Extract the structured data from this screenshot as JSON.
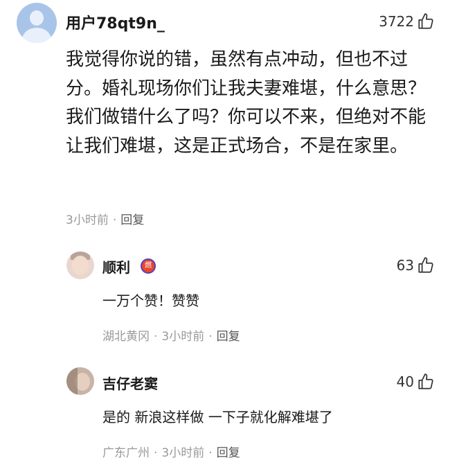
{
  "main_comment": {
    "username": "用户78qt9n_",
    "likes": "3722",
    "text": "我觉得你说的错，虽然有点冲动，但也不过分。婚礼现场你们让我夫妻难堪，什么意思？我们做错什么了吗？你可以不来，但绝对不能让我们难堪，这是正式场合，不是在家里。",
    "time": "3小时前",
    "reply_label": "回复",
    "avatar_icon": "default-user-icon"
  },
  "replies": [
    {
      "username": "顺利",
      "badge": "燃",
      "likes": "63",
      "text": "一万个赞！赞赞",
      "location": "湖北黄冈",
      "time": "3小时前",
      "reply_label": "回复"
    },
    {
      "username": "吉仔老窦",
      "likes": "40",
      "text": "是的 新浪这样做 一下子就化解难堪了",
      "location": "广东广州",
      "time": "3小时前",
      "reply_label": "回复"
    }
  ],
  "colors": {
    "meta": "#999999",
    "text": "#1a1a1a",
    "badge": "#e8472f"
  }
}
